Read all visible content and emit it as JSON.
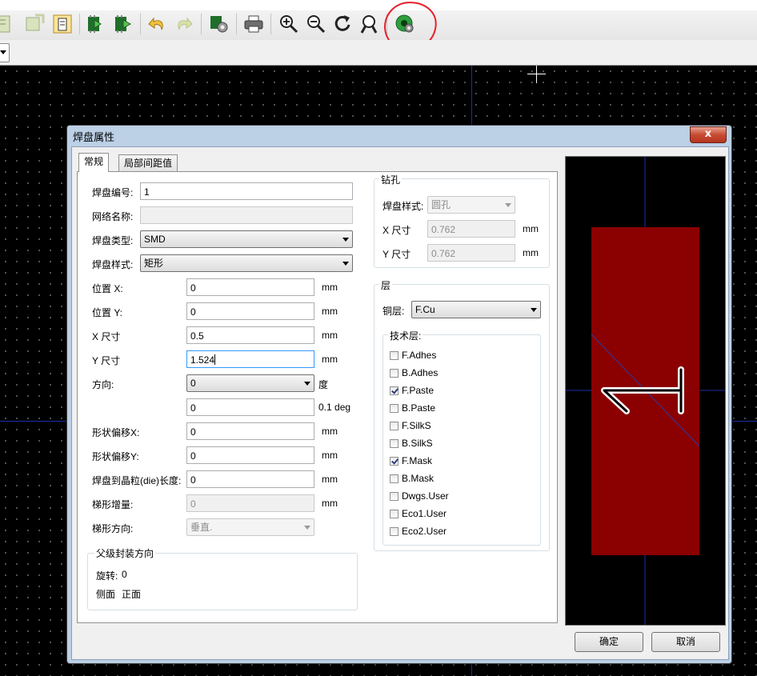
{
  "toolbar": {
    "buttons": [
      "load-footprint-icon",
      "update-footprint-icon",
      "footprint-properties-icon",
      "insert-footprint-icon",
      "save-footprint-icon",
      "undo-icon",
      "redo-icon",
      "library-settings-icon",
      "print-icon",
      "zoom-in-icon",
      "zoom-out-icon",
      "redraw-icon",
      "zoom-fit-icon",
      "pad-settings-icon"
    ]
  },
  "dialog": {
    "title": "焊盘属性",
    "close_glyph": "x",
    "tabs": [
      {
        "label": "常规",
        "active": true
      },
      {
        "label": "局部间距值",
        "active": false
      }
    ],
    "general": {
      "pad_number_label": "焊盘编号:",
      "pad_number_value": "1",
      "net_name_label": "网络名称:",
      "net_name_value": "",
      "pad_type_label": "焊盘类型:",
      "pad_type_value": "SMD",
      "pad_shape_label": "焊盘样式:",
      "pad_shape_value": "矩形",
      "pos_x_label": "位置 X:",
      "pos_x_value": "0",
      "pos_x_unit": "mm",
      "pos_y_label": "位置 Y:",
      "pos_y_value": "0",
      "pos_y_unit": "mm",
      "size_x_label": "X 尺寸",
      "size_x_value": "0.5",
      "size_x_unit": "mm",
      "size_y_label": "Y 尺寸",
      "size_y_value": "1.524",
      "size_y_unit": "mm",
      "orientation_label": "方向:",
      "orientation_value": "0",
      "orientation_unit": "度",
      "orientation_custom_value": "0",
      "orientation_custom_unit": "0.1 deg",
      "offset_x_label": "形状偏移X:",
      "offset_x_value": "0",
      "offset_x_unit": "mm",
      "offset_y_label": "形状偏移Y:",
      "offset_y_value": "0",
      "offset_y_unit": "mm",
      "die_length_label": "焊盘到晶粒(die)长度:",
      "die_length_value": "0",
      "die_length_unit": "mm",
      "trap_delta_label": "梯形增量:",
      "trap_delta_value": "0",
      "trap_delta_unit": "mm",
      "trap_dir_label": "梯形方向:",
      "trap_dir_value": "垂直."
    },
    "parent": {
      "title": "父级封装方向",
      "rotation_label": "旋转:",
      "rotation_value": "0",
      "side_label": "侧面",
      "side_value": "正面"
    },
    "drill": {
      "title": "钻孔",
      "shape_label": "焊盘样式:",
      "shape_value": "圆孔",
      "x_label": "X 尺寸",
      "x_value": "0.762",
      "x_unit": "mm",
      "y_label": "Y 尺寸",
      "y_value": "0.762",
      "y_unit": "mm"
    },
    "layers": {
      "title": "层",
      "copper_label": "铜层:",
      "copper_value": "F.Cu",
      "tech_title": "技术层:",
      "items": [
        {
          "label": "F.Adhes",
          "checked": false
        },
        {
          "label": "B.Adhes",
          "checked": false
        },
        {
          "label": "F.Paste",
          "checked": true
        },
        {
          "label": "B.Paste",
          "checked": false
        },
        {
          "label": "F.SilkS",
          "checked": false
        },
        {
          "label": "B.SilkS",
          "checked": false
        },
        {
          "label": "F.Mask",
          "checked": true
        },
        {
          "label": "B.Mask",
          "checked": false
        },
        {
          "label": "Dwgs.User",
          "checked": false
        },
        {
          "label": "Eco1.User",
          "checked": false
        },
        {
          "label": "Eco2.User",
          "checked": false
        }
      ]
    },
    "preview": {
      "pad_color": "#8b0000",
      "pad_number": "1"
    },
    "ok_label": "确定",
    "cancel_label": "取消"
  },
  "colors": {
    "annotation": "#e8202a",
    "canvas_axis": "#1b2ea8"
  }
}
